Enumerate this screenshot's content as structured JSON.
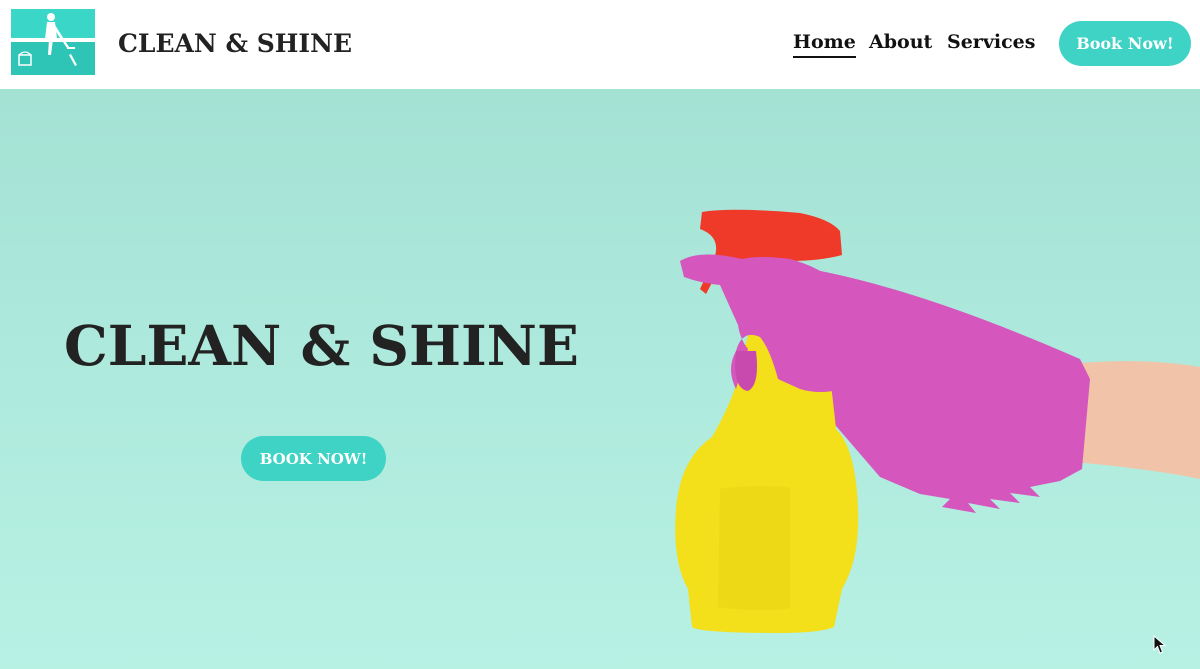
{
  "header": {
    "brand": "CLEAN & SHINE",
    "logo_icon": "cleaning-person-logo-icon",
    "nav": {
      "home": "Home",
      "about": "About",
      "services": "Services"
    },
    "cta_label": "Book Now!"
  },
  "hero": {
    "title": "CLEAN & SHINE",
    "cta_label": "BOOK NOW!",
    "image_icon": "spray-bottle-glove-photo"
  },
  "colors": {
    "accent": "#3fd3c5",
    "hero_background": "#ade9dc",
    "glove": "#d859c0",
    "bottle": "#f5e21c",
    "trigger": "#f03a2a",
    "text": "#222222"
  }
}
